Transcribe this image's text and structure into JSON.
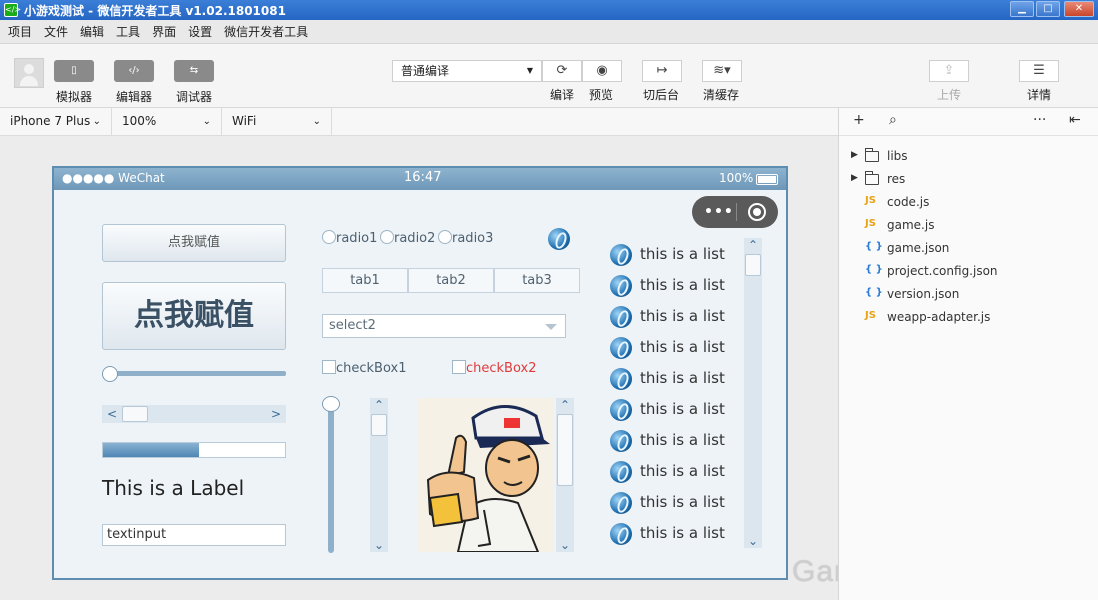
{
  "window": {
    "icon_text": "</>",
    "title": "小游戏测试 - 微信开发者工具 v1.02.1801081",
    "min_glyph": "▁",
    "max_glyph": "□",
    "close_glyph": "✕"
  },
  "menu": [
    "项目",
    "文件",
    "编辑",
    "工具",
    "界面",
    "设置",
    "微信开发者工具"
  ],
  "toolbar": {
    "simulator_label": "模拟器",
    "editor_label": "编辑器",
    "debugger_label": "调试器",
    "compile_mode": "普通编译",
    "compile_label": "编译",
    "preview_label": "预览",
    "background_label": "切后台",
    "clear_cache_label": "清缓存",
    "upload_label": "上传",
    "details_label": "详情",
    "icons": {
      "simulator": "phone-icon",
      "editor": "code-icon",
      "debugger": "debug-icon",
      "compile": "refresh-icon",
      "preview": "eye-icon",
      "background": "switch-icon",
      "clear_cache": "layers-icon",
      "upload": "upload-icon",
      "details": "menu-icon"
    }
  },
  "devicebar": {
    "device": "iPhone 7 Plus",
    "zoom": "100%",
    "network": "WiFi"
  },
  "phone": {
    "carrier": "●●●●● WeChat",
    "time": "16:47",
    "battery": "100%",
    "button_small": "点我赋值",
    "button_big": "点我赋值",
    "slider_value": 0,
    "hscroll_arrows": [
      "<",
      ">"
    ],
    "progress": 0.53,
    "label": "This is a Label",
    "textinput": "textinput",
    "radios": [
      "radio1",
      "radio2",
      "radio3"
    ],
    "tabs": [
      "tab1",
      "tab2",
      "tab3"
    ],
    "select": "select2",
    "checkboxes": [
      "checkBox1",
      "checkBox2"
    ],
    "checkbox2_color": "#e03b3b",
    "list_items": [
      "this is a list",
      "this is a list",
      "this is a list",
      "this is a list",
      "this is a list",
      "this is a list",
      "this is a list",
      "this is a list",
      "this is a list",
      "this is a list"
    ],
    "scroll_arrow_up": "⌃",
    "scroll_arrow_down": "⌄"
  },
  "filetree": {
    "items": [
      {
        "name": "libs",
        "type": "folder"
      },
      {
        "name": "res",
        "type": "folder"
      },
      {
        "name": "code.js",
        "type": "js"
      },
      {
        "name": "game.js",
        "type": "js"
      },
      {
        "name": "game.json",
        "type": "json"
      },
      {
        "name": "project.config.json",
        "type": "json"
      },
      {
        "name": "version.json",
        "type": "json"
      },
      {
        "name": "weapp-adapter.js",
        "type": "js"
      }
    ],
    "js_color": "#e8a317",
    "json_color": "#2b7bd6"
  },
  "watermark": "GameRes游资网"
}
